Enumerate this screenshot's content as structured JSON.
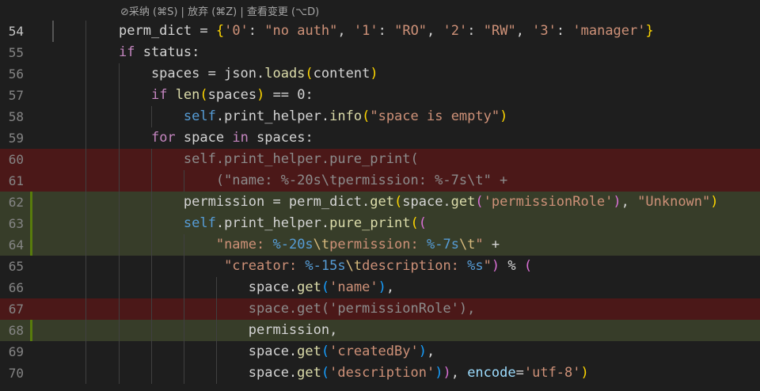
{
  "codelens": "⊘采纳 (⌘S) | 放弃 (⌘Z) | 查看变更 (⌥D)",
  "lines": [
    {
      "num": "54",
      "state": "current",
      "tokens": [
        [
          "var",
          "perm_dict = "
        ],
        [
          "br1",
          "{"
        ],
        [
          "str",
          "'0'"
        ],
        [
          "var",
          ": "
        ],
        [
          "str",
          "\"no auth\""
        ],
        [
          "var",
          ", "
        ],
        [
          "str",
          "'1'"
        ],
        [
          "var",
          ": "
        ],
        [
          "str",
          "\"RO\""
        ],
        [
          "var",
          ", "
        ],
        [
          "str",
          "'2'"
        ],
        [
          "var",
          ": "
        ],
        [
          "str",
          "\"RW\""
        ],
        [
          "var",
          ", "
        ],
        [
          "str",
          "'3'"
        ],
        [
          "var",
          ": "
        ],
        [
          "str",
          "'manager'"
        ],
        [
          "br1",
          "}"
        ]
      ]
    },
    {
      "num": "55",
      "state": "normal",
      "tokens": [
        [
          "kw",
          "if"
        ],
        [
          "var",
          " status:"
        ]
      ]
    },
    {
      "num": "56",
      "state": "normal",
      "tokens": [
        [
          "var",
          "    spaces = json."
        ],
        [
          "fn",
          "loads"
        ],
        [
          "br1",
          "("
        ],
        [
          "var",
          "content"
        ],
        [
          "br1",
          ")"
        ]
      ]
    },
    {
      "num": "57",
      "state": "normal",
      "tokens": [
        [
          "var",
          "    "
        ],
        [
          "kw",
          "if"
        ],
        [
          "var",
          " "
        ],
        [
          "fn",
          "len"
        ],
        [
          "br1",
          "("
        ],
        [
          "var",
          "spaces"
        ],
        [
          "br1",
          ")"
        ],
        [
          "var",
          " == 0:"
        ]
      ]
    },
    {
      "num": "58",
      "state": "normal",
      "tokens": [
        [
          "var",
          "        "
        ],
        [
          "self",
          "self"
        ],
        [
          "var",
          ".print_helper."
        ],
        [
          "fn",
          "info"
        ],
        [
          "br1",
          "("
        ],
        [
          "str",
          "\"space is empty\""
        ],
        [
          "br1",
          ")"
        ]
      ]
    },
    {
      "num": "59",
      "state": "normal",
      "tokens": [
        [
          "var",
          "    "
        ],
        [
          "kw",
          "for"
        ],
        [
          "var",
          " space "
        ],
        [
          "kw",
          "in"
        ],
        [
          "var",
          " spaces:"
        ]
      ]
    },
    {
      "num": "60",
      "state": "deleted",
      "tokens": [
        [
          "var",
          "        self.print_helper.pure_print("
        ]
      ]
    },
    {
      "num": "61",
      "state": "deleted",
      "tokens": [
        [
          "var",
          "            (\"name: %-20s\\tpermission: %-7s\\t\" +"
        ]
      ]
    },
    {
      "num": "62",
      "state": "added",
      "tokens": [
        [
          "var",
          "        permission = perm_dict."
        ],
        [
          "fn",
          "get"
        ],
        [
          "br1",
          "("
        ],
        [
          "var",
          "space."
        ],
        [
          "fn",
          "get"
        ],
        [
          "br2",
          "("
        ],
        [
          "str",
          "'permissionRole'"
        ],
        [
          "br2",
          ")"
        ],
        [
          "var",
          ", "
        ],
        [
          "str",
          "\"Unknown\""
        ],
        [
          "br1",
          ")"
        ]
      ]
    },
    {
      "num": "63",
      "state": "added",
      "tokens": [
        [
          "var",
          "        "
        ],
        [
          "self",
          "self"
        ],
        [
          "var",
          ".print_helper."
        ],
        [
          "fn",
          "pure_print"
        ],
        [
          "br1",
          "("
        ],
        [
          "br2",
          "("
        ]
      ]
    },
    {
      "num": "64",
      "state": "added",
      "tokens": [
        [
          "var",
          "            "
        ],
        [
          "str",
          "\"name: "
        ],
        [
          "fmt",
          "%-20s"
        ],
        [
          "esc",
          "\\t"
        ],
        [
          "str",
          "permission: "
        ],
        [
          "fmt",
          "%-7s"
        ],
        [
          "esc",
          "\\t"
        ],
        [
          "str",
          "\""
        ],
        [
          "var",
          " +"
        ]
      ]
    },
    {
      "num": "65",
      "state": "normal",
      "tokens": [
        [
          "var",
          "             "
        ],
        [
          "str",
          "\"creator: "
        ],
        [
          "fmt",
          "%-15s"
        ],
        [
          "esc",
          "\\t"
        ],
        [
          "str",
          "description: "
        ],
        [
          "fmt",
          "%s"
        ],
        [
          "str",
          "\""
        ],
        [
          "br2",
          ")"
        ],
        [
          "var",
          " % "
        ],
        [
          "br2",
          "("
        ]
      ]
    },
    {
      "num": "66",
      "state": "normal",
      "tokens": [
        [
          "var",
          "                space."
        ],
        [
          "fn",
          "get"
        ],
        [
          "br3",
          "("
        ],
        [
          "str",
          "'name'"
        ],
        [
          "br3",
          ")"
        ],
        [
          "var",
          ","
        ]
      ]
    },
    {
      "num": "67",
      "state": "deleted",
      "tokens": [
        [
          "var",
          "                space.get('permissionRole'),"
        ]
      ]
    },
    {
      "num": "68",
      "state": "added",
      "tokens": [
        [
          "var",
          "                permission,"
        ]
      ]
    },
    {
      "num": "69",
      "state": "normal",
      "tokens": [
        [
          "var",
          "                space."
        ],
        [
          "fn",
          "get"
        ],
        [
          "br3",
          "("
        ],
        [
          "str",
          "'createdBy'"
        ],
        [
          "br3",
          ")"
        ],
        [
          "var",
          ","
        ]
      ]
    },
    {
      "num": "70",
      "state": "normal",
      "tokens": [
        [
          "var",
          "                space."
        ],
        [
          "fn",
          "get"
        ],
        [
          "br3",
          "("
        ],
        [
          "str",
          "'description'"
        ],
        [
          "br3",
          ")"
        ],
        [
          "br2",
          ")"
        ],
        [
          "var",
          ", "
        ],
        [
          "param",
          "encode"
        ],
        [
          "var",
          "="
        ],
        [
          "str",
          "'utf-8'"
        ],
        [
          "br1",
          ")"
        ]
      ]
    }
  ]
}
